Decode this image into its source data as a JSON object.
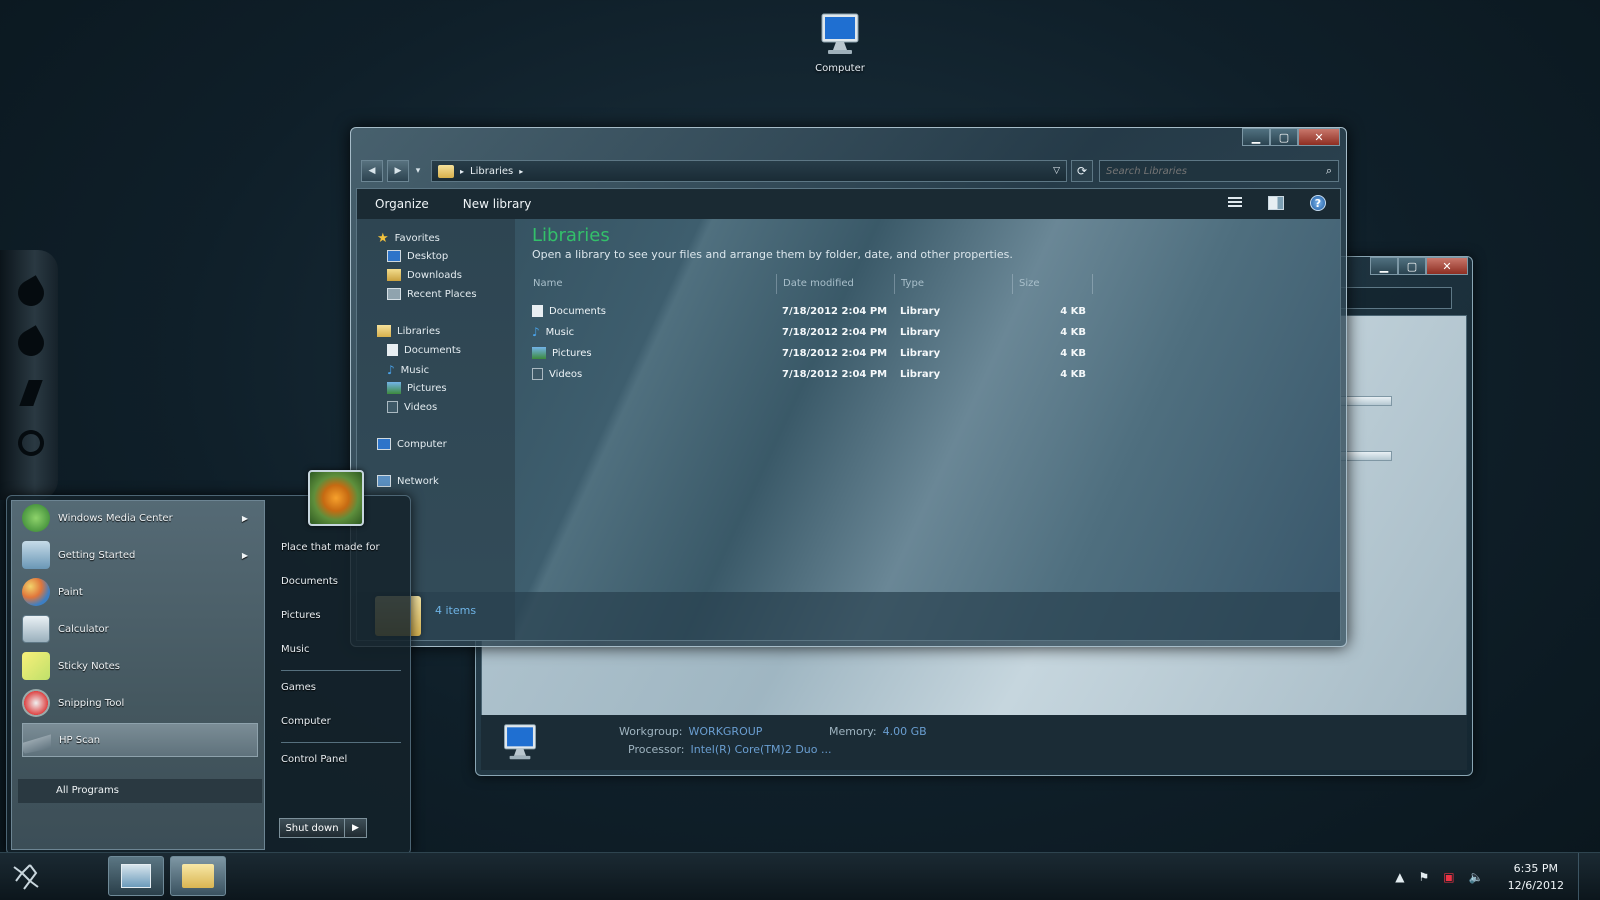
{
  "desktop": {
    "computer_icon_label": "Computer"
  },
  "back_window": {
    "search_placeholder": "",
    "workgroup_label": "Workgroup:",
    "workgroup_value": "WORKGROUP",
    "memory_label": "Memory:",
    "memory_value": "4.00 GB",
    "processor_label": "Processor:",
    "processor_value": "Intel(R) Core(TM)2 Duo ..."
  },
  "explorer": {
    "breadcrumb": "Libraries",
    "search_placeholder": "Search Libraries",
    "toolbar": {
      "organize": "Organize",
      "new_library": "New library"
    },
    "nav": {
      "favorites": "Favorites",
      "desktop": "Desktop",
      "downloads": "Downloads",
      "recent_places": "Recent Places",
      "libraries": "Libraries",
      "documents": "Documents",
      "music": "Music",
      "pictures": "Pictures",
      "videos": "Videos",
      "computer": "Computer",
      "network": "Network"
    },
    "header": {
      "title": "Libraries",
      "description": "Open a library to see your files and arrange them by folder, date, and other properties."
    },
    "columns": [
      "Name",
      "Date modified",
      "Type",
      "Size"
    ],
    "files": [
      {
        "name": "Documents",
        "date": "7/18/2012 2:04 PM",
        "type": "Library",
        "size": "4 KB"
      },
      {
        "name": "Music",
        "date": "7/18/2012 2:04 PM",
        "type": "Library",
        "size": "4 KB"
      },
      {
        "name": "Pictures",
        "date": "7/18/2012 2:04 PM",
        "type": "Library",
        "size": "4 KB"
      },
      {
        "name": "Videos",
        "date": "7/18/2012 2:04 PM",
        "type": "Library",
        "size": "4 KB"
      }
    ],
    "status": "4 items"
  },
  "start_menu": {
    "programs": [
      {
        "label": "Windows Media Center",
        "arrow": "▶"
      },
      {
        "label": "Getting Started",
        "arrow": "▶"
      },
      {
        "label": "Paint",
        "arrow": ""
      },
      {
        "label": "Calculator",
        "arrow": ""
      },
      {
        "label": "Sticky Notes",
        "arrow": ""
      },
      {
        "label": "Snipping Tool",
        "arrow": ""
      },
      {
        "label": "HP Scan",
        "arrow": ""
      }
    ],
    "all_programs": "All Programs",
    "places": {
      "user": "Place that made for",
      "documents": "Documents",
      "pictures": "Pictures",
      "music": "Music",
      "games": "Games",
      "computer": "Computer",
      "control_panel": "Control Panel"
    },
    "shutdown": "Shut down"
  },
  "taskbar": {
    "time": "6:35 PM",
    "date": "12/6/2012"
  },
  "colors": {
    "accent_green": "#33c06a",
    "link_blue": "#6a9ed1"
  }
}
